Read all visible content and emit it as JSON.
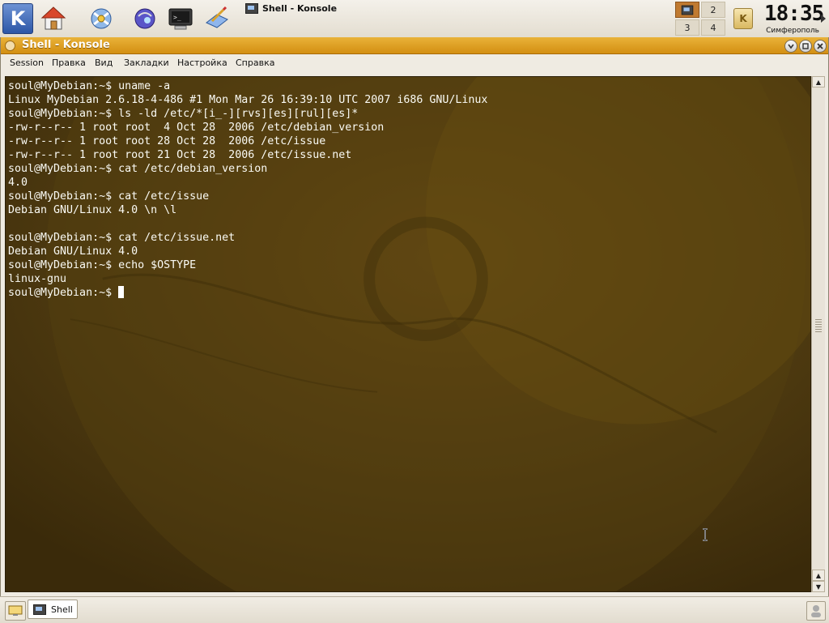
{
  "kicker": {
    "launchers": [
      {
        "icon": "kde-menu-icon"
      },
      {
        "icon": "home-folder-icon"
      },
      {
        "icon": "konqueror-browser-icon"
      },
      {
        "icon": "web-browser-globe-icon"
      },
      {
        "icon": "terminal-icon"
      },
      {
        "icon": "text-editor-icon"
      }
    ],
    "active_task": "Shell - Konsole",
    "pager": [
      "1",
      "2",
      "3",
      "4"
    ],
    "clock_time": "18:35",
    "clock_city": "Симферополь",
    "klipper_label": "K"
  },
  "window": {
    "title": "Shell - Konsole",
    "menu": [
      "Session",
      "Правка",
      "Вид",
      "Закладки",
      "Настройка",
      "Справка"
    ]
  },
  "terminal": {
    "lines": [
      "soul@MyDebian:~$ uname -a",
      "Linux MyDebian 2.6.18-4-486 #1 Mon Mar 26 16:39:10 UTC 2007 i686 GNU/Linux",
      "soul@MyDebian:~$ ls -ld /etc/*[i_-][rvs][es][rul][es]*",
      "-rw-r--r-- 1 root root  4 Oct 28  2006 /etc/debian_version",
      "-rw-r--r-- 1 root root 28 Oct 28  2006 /etc/issue",
      "-rw-r--r-- 1 root root 21 Oct 28  2006 /etc/issue.net",
      "soul@MyDebian:~$ cat /etc/debian_version",
      "4.0",
      "soul@MyDebian:~$ cat /etc/issue",
      "Debian GNU/Linux 4.0 \\n \\l",
      "",
      "soul@MyDebian:~$ cat /etc/issue.net",
      "Debian GNU/Linux 4.0",
      "soul@MyDebian:~$ echo $OSTYPE",
      "linux-gnu"
    ],
    "prompt": "soul@MyDebian:~$ "
  },
  "taskbar": {
    "tasks": [
      {
        "label": "Shell"
      }
    ]
  },
  "colors": {
    "titlebar": "#d89a1c",
    "terminal_bg": "#46330f",
    "terminal_fg": "#fbfbf5"
  }
}
